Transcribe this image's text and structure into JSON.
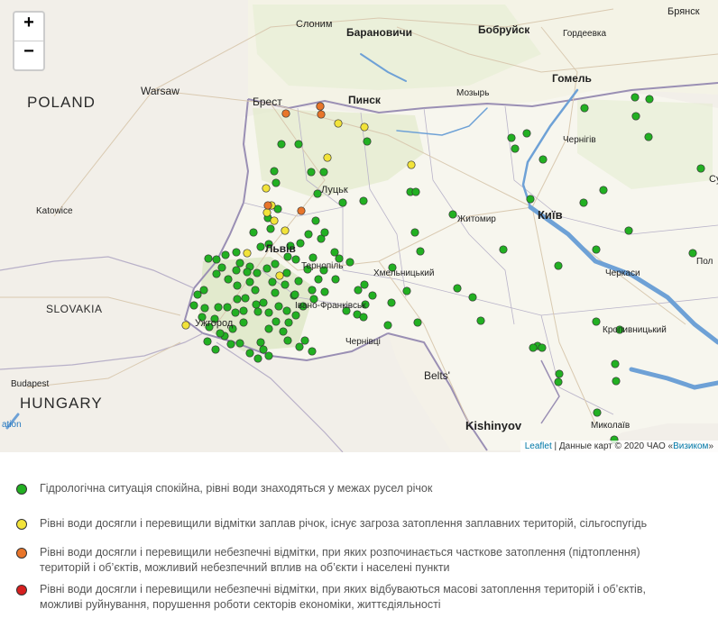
{
  "map": {
    "zoom_in_label": "+",
    "zoom_out_label": "−",
    "countries": [
      {
        "id": "poland",
        "name": "POLAND"
      },
      {
        "id": "slovakia",
        "name": "SLOVAKIA"
      },
      {
        "id": "hungary",
        "name": "HUNGARY"
      }
    ],
    "cities": [
      {
        "id": "warsaw",
        "name": "Warsaw"
      },
      {
        "id": "katowice",
        "name": "Katowice"
      },
      {
        "id": "budapest",
        "name": "Budapest"
      },
      {
        "id": "slonim",
        "name": "Слоним"
      },
      {
        "id": "baranovichi",
        "name": "Барановичи"
      },
      {
        "id": "bobruisk",
        "name": "Бобруйск"
      },
      {
        "id": "bryansk",
        "name": "Брянск"
      },
      {
        "id": "gordeevka",
        "name": "Гордеевка"
      },
      {
        "id": "brest",
        "name": "Брест"
      },
      {
        "id": "pinsk",
        "name": "Пинск"
      },
      {
        "id": "mozyr",
        "name": "Мозырь"
      },
      {
        "id": "gomel",
        "name": "Гомель"
      },
      {
        "id": "chernihiv",
        "name": "Чернігів"
      },
      {
        "id": "lutsk",
        "name": "Луцьк"
      },
      {
        "id": "zhytomyr",
        "name": "Житомир"
      },
      {
        "id": "kyiv",
        "name": "Київ"
      },
      {
        "id": "lviv",
        "name": "Львів"
      },
      {
        "id": "ternopil",
        "name": "Тернопіль"
      },
      {
        "id": "khmelnytskyi",
        "name": "Хмельницький"
      },
      {
        "id": "cherkasy",
        "name": "Черкаси"
      },
      {
        "id": "ivano",
        "name": "Івано-Франківськ"
      },
      {
        "id": "uzhhorod",
        "name": "Ужгород"
      },
      {
        "id": "chernivtsi",
        "name": "Чернівці"
      },
      {
        "id": "kropyvnytskyi",
        "name": "Кропивницький"
      },
      {
        "id": "beltsy",
        "name": "Belts'"
      },
      {
        "id": "kishinyov",
        "name": "Kishinyov"
      },
      {
        "id": "mykolaiv",
        "name": "Миколаїв"
      },
      {
        "id": "sumy",
        "name": "Су"
      },
      {
        "id": "poltava",
        "name": "Пол"
      },
      {
        "id": "ation",
        "name": "ation"
      }
    ],
    "attribution": {
      "leaflet": "Leaflet",
      "sep": " | Данные карт © 2020 ЧАО «",
      "provider": "Визиком",
      "end": "»"
    }
  },
  "status_colors": {
    "green": "#22b022",
    "yellow": "#f2e33a",
    "orange": "#e8752a",
    "red": "#d61f1f"
  },
  "gauges": {
    "green_count": 153,
    "yellow_count": 12,
    "orange_count": 5,
    "red_count": 0
  },
  "legend": [
    {
      "status": "green",
      "text": "Гідрологічна ситуація спокійна, рівні води знаходяться у межах русел річок"
    },
    {
      "status": "yellow",
      "text": "Рівні води досягли і перевищили відмітки заплав річок, існує загроза затоплення заплавних територій, сільгоспугідь"
    },
    {
      "status": "orange",
      "text": "Рівні води досягли і перевищили небезпечні відмітки, при яких розпочинається часткове затоплення (підтоплення) територій і об’єктів, можливий небезпечний вплив на об’єкти і населені пункти"
    },
    {
      "status": "red",
      "text": "Рівні води досягли і перевищили небезпечні відмітки, при яких відбуваються масові затоплення територій і об’єктів, можливі руйнування, порушення роботи секторів економіки, життєдіяльності"
    }
  ]
}
